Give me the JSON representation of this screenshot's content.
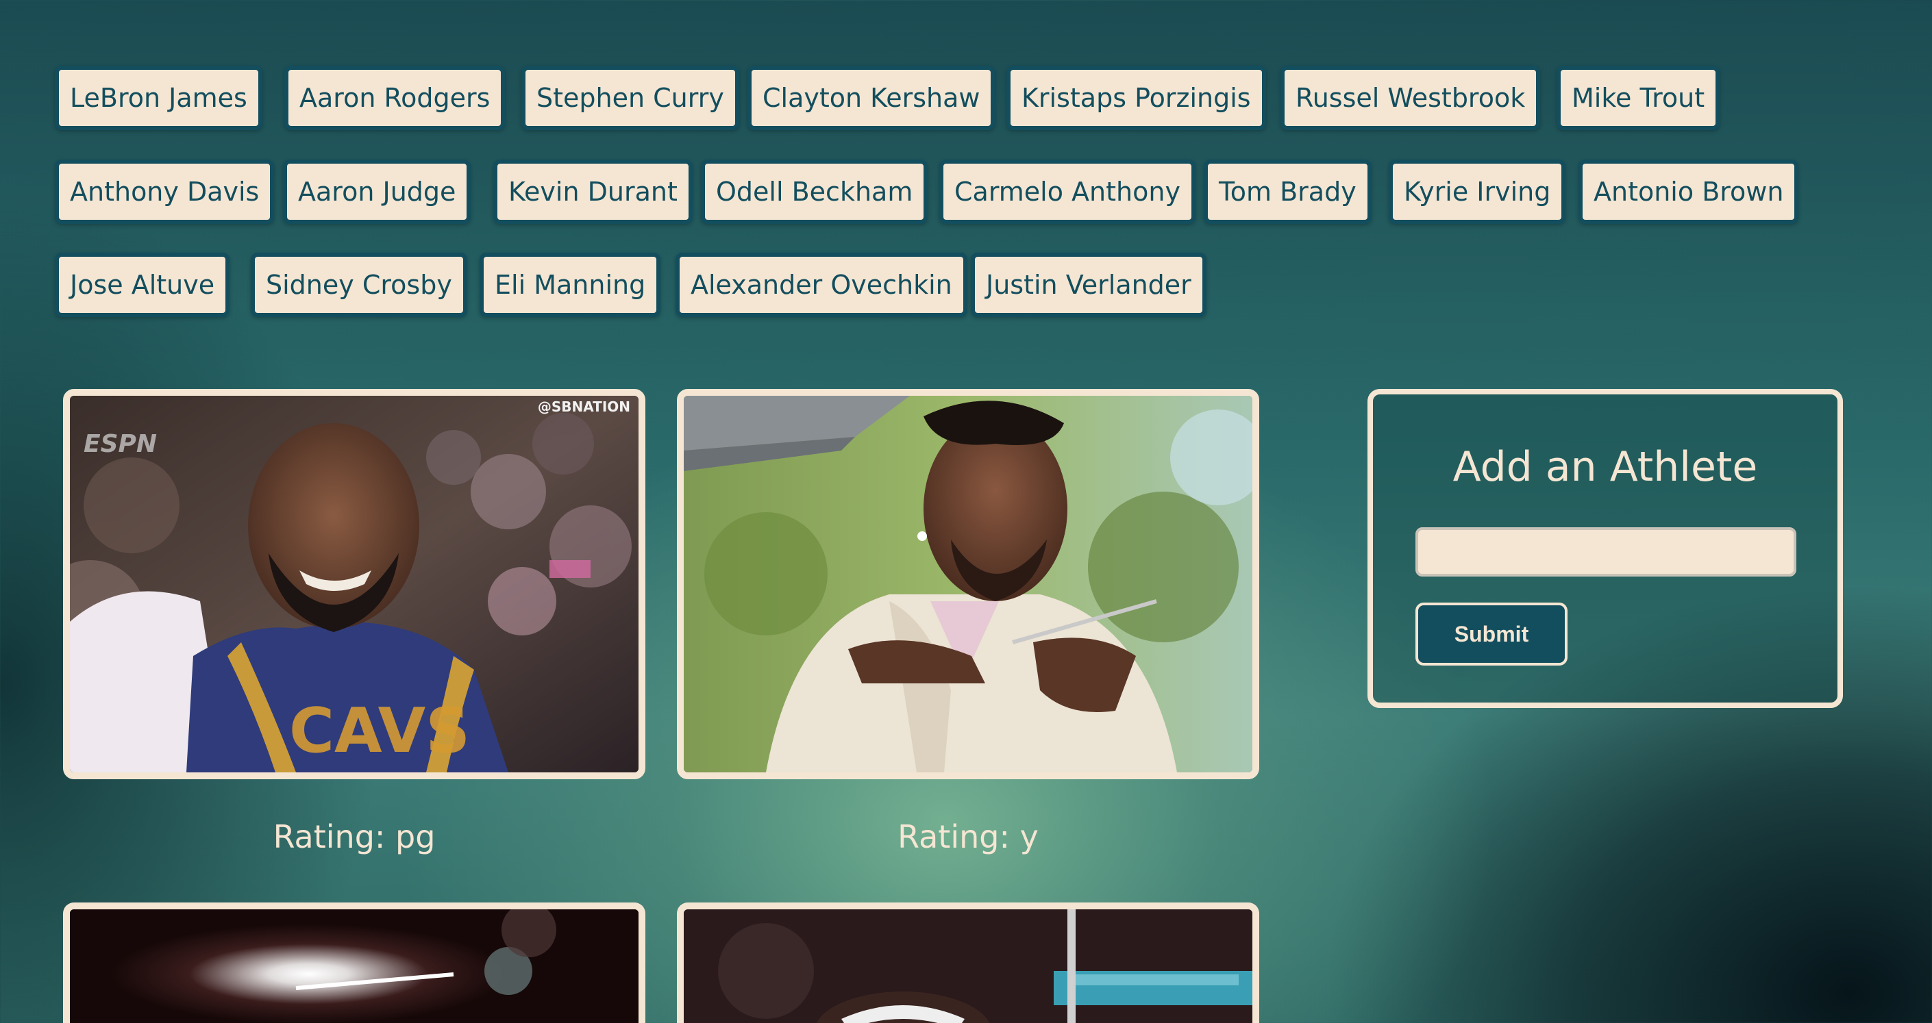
{
  "athletes": [
    {
      "label": "LeBron James"
    },
    {
      "label": "Aaron Rodgers"
    },
    {
      "label": "Stephen Curry"
    },
    {
      "label": "Clayton Kershaw"
    },
    {
      "label": "Kristaps Porzingis"
    },
    {
      "label": "Russel Westbrook"
    },
    {
      "label": "Mike Trout"
    },
    {
      "label": "Anthony Davis"
    },
    {
      "label": "Aaron Judge"
    },
    {
      "label": "Kevin Durant"
    },
    {
      "label": "Odell Beckham"
    },
    {
      "label": "Carmelo Anthony"
    },
    {
      "label": "Tom Brady"
    },
    {
      "label": "Kyrie Irving"
    },
    {
      "label": "Antonio Brown"
    },
    {
      "label": "Jose Altuve"
    },
    {
      "label": "Sidney Crosby"
    },
    {
      "label": "Eli Manning"
    },
    {
      "label": "Alexander Ovechkin"
    },
    {
      "label": "Justin Verlander"
    }
  ],
  "gifs": [
    {
      "rating": "Rating: pg",
      "watermark": "@SBNATION",
      "logo": "ESPN"
    },
    {
      "rating": "Rating: y"
    },
    {},
    {}
  ],
  "form": {
    "title": "Add an Athlete",
    "input_value": "",
    "input_placeholder": "",
    "submit_label": "Submit"
  },
  "colors": {
    "cream": "#f5e6d3",
    "teal_dark": "#134e5e",
    "bg_light": "#76b292",
    "bg_dark": "#0a1a20"
  }
}
